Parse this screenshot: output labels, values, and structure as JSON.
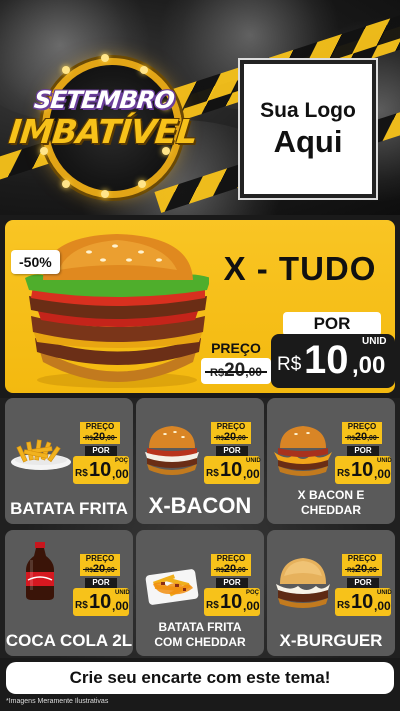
{
  "header": {
    "badge_line1": "SETEMBRO",
    "badge_line2": "IMBATÍVEL",
    "logo_line1": "Sua Logo",
    "logo_line2": "Aqui"
  },
  "featured": {
    "discount": "-50%",
    "name": "X - TUDO",
    "preco_label": "PREÇO",
    "old_currency": "R$",
    "old_int": "20",
    "old_cents": ",00",
    "por_label": "POR",
    "new_currency": "R$",
    "new_int": "10",
    "new_cents": ",00",
    "unit": "UNID"
  },
  "products": [
    {
      "name": "BATATA FRITA",
      "preco_label": "PREÇO",
      "old_currency": "R$",
      "old_int": "20",
      "old_cents": ",00",
      "por_label": "POR",
      "currency": "R$",
      "price_int": "10",
      "price_cents": ",00",
      "unit": "POÇ",
      "icon": "fries-icon"
    },
    {
      "name": "X-BACON",
      "preco_label": "PREÇO",
      "old_currency": "R$",
      "old_int": "20",
      "old_cents": ",00",
      "por_label": "POR",
      "currency": "R$",
      "price_int": "10",
      "price_cents": ",00",
      "unit": "UNID",
      "icon": "burger-icon"
    },
    {
      "name": "X BACON E CHEDDAR",
      "preco_label": "PREÇO",
      "old_currency": "R$",
      "old_int": "20",
      "old_cents": ",00",
      "por_label": "POR",
      "currency": "R$",
      "price_int": "10",
      "price_cents": ",00",
      "unit": "UNID",
      "icon": "cheddar-burger-icon"
    },
    {
      "name": "COCA COLA 2L",
      "preco_label": "PREÇO",
      "old_currency": "R$",
      "old_int": "20",
      "old_cents": ",00",
      "por_label": "POR",
      "currency": "R$",
      "price_int": "10",
      "price_cents": ",00",
      "unit": "UNID",
      "icon": "soda-bottle-icon"
    },
    {
      "name": "BATATA FRITA COM CHEDDAR",
      "preco_label": "PREÇO",
      "old_currency": "R$",
      "old_int": "20",
      "old_cents": ",00",
      "por_label": "POR",
      "currency": "R$",
      "price_int": "10",
      "price_cents": ",00",
      "unit": "POÇ",
      "icon": "cheddar-fries-icon"
    },
    {
      "name": "X-BURGUER",
      "preco_label": "PREÇO",
      "old_currency": "R$",
      "old_int": "20",
      "old_cents": ",00",
      "por_label": "POR",
      "currency": "R$",
      "price_int": "10",
      "price_cents": ",00",
      "unit": "UNID",
      "icon": "cheeseburger-icon"
    }
  ],
  "footer": {
    "cta": "Crie seu encarte com este tema!",
    "disclaimer": "*Imagens Meramente Ilustrativas"
  },
  "colors": {
    "accent_yellow": "#f7c21a",
    "dark": "#1a1a1a",
    "card_gray": "#5a5a5a",
    "badge_purple": "#6a3e9a"
  }
}
